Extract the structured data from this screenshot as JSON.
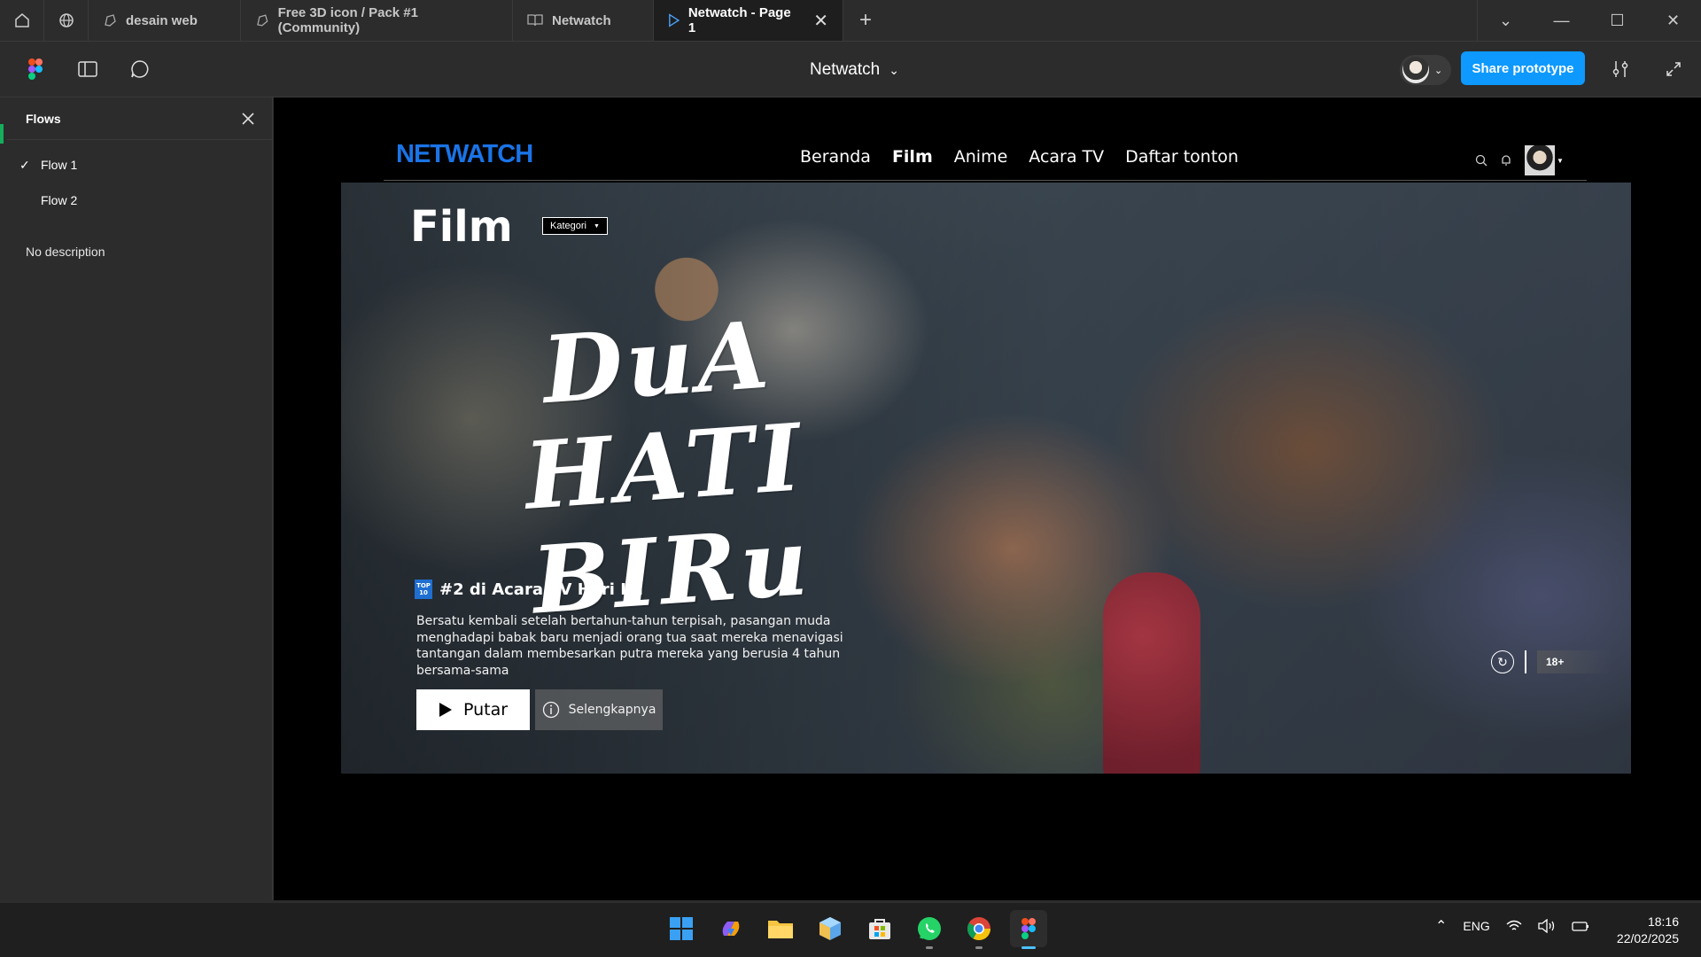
{
  "tabs": [
    {
      "label": "desain web",
      "icon": "figma-file-icon"
    },
    {
      "label": "Free 3D icon / Pack #1 (Community)",
      "icon": "figma-file-icon"
    },
    {
      "label": "Netwatch",
      "icon": "book-icon"
    },
    {
      "label": "Netwatch - Page 1",
      "icon": "play-icon",
      "active": true
    }
  ],
  "toolbar": {
    "title": "Netwatch",
    "share_label": "Share prototype"
  },
  "panel": {
    "heading": "Flows",
    "flows": [
      "Flow 1",
      "Flow 2"
    ],
    "selected_flow": "Flow 1",
    "description": "No description"
  },
  "site": {
    "logo": "NETWATCH",
    "nav": [
      "Beranda",
      "Film",
      "Anime",
      "Acara TV",
      "Daftar tonton"
    ],
    "active_nav": "Film"
  },
  "hero": {
    "page_title": "Film",
    "category_label": "Kategori",
    "movie_title_line1": "DuA HATI",
    "movie_title_line2": "BIRu",
    "top_badge": "TOP 10",
    "rank_text": "#2 di Acara TV Hari Ini",
    "description": "Bersatu kembali setelah bertahun-tahun terpisah, pasangan muda menghadapi babak baru menjadi orang tua saat mereka menavigasi tantangan dalam membesarkan putra mereka yang berusia 4 tahun bersama-sama",
    "play_label": "Putar",
    "info_label": "Selengkapnya",
    "rating": "18+"
  },
  "taskbar": {
    "apps": [
      "windows-start",
      "copilot",
      "file-explorer",
      "3d-viewer",
      "microsoft-store",
      "whatsapp",
      "chrome",
      "figma"
    ],
    "language": "ENG",
    "time": "18:16",
    "date": "22/02/2025"
  },
  "colors": {
    "accent": "#0d99ff",
    "logo": "#1a74e6",
    "canvas": "#000000",
    "chrome": "#2c2c2c"
  }
}
